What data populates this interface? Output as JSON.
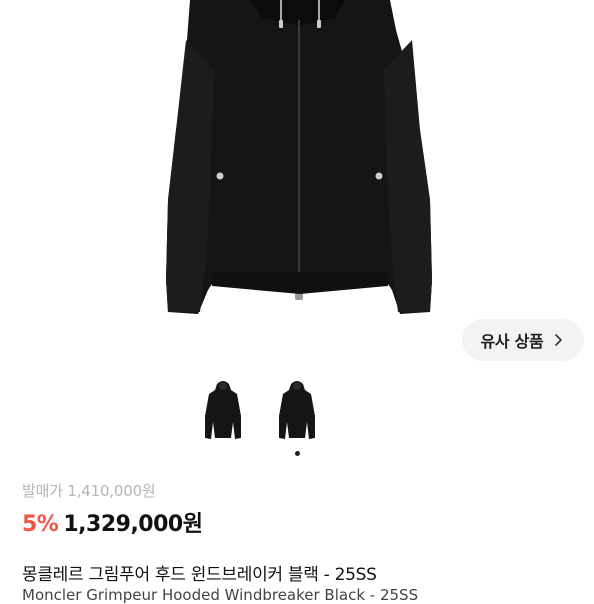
{
  "similar": {
    "label": "유사 상품",
    "icon": "chevron-right-icon"
  },
  "gallery": {
    "thumbnails": 2,
    "active_index": 1
  },
  "price": {
    "original": "발매가 1,410,000원",
    "discount": "5%",
    "sale": "1,329,000원"
  },
  "product": {
    "title": "몽클레르 그림푸어 후드 윈드브레이커 블랙 - 25SS",
    "subtitle": "Moncler Grimpeur Hooded Windbreaker Black - 25SS"
  },
  "colors": {
    "discount": "#f15746",
    "dot": "#222222",
    "jacket": "#151515"
  }
}
